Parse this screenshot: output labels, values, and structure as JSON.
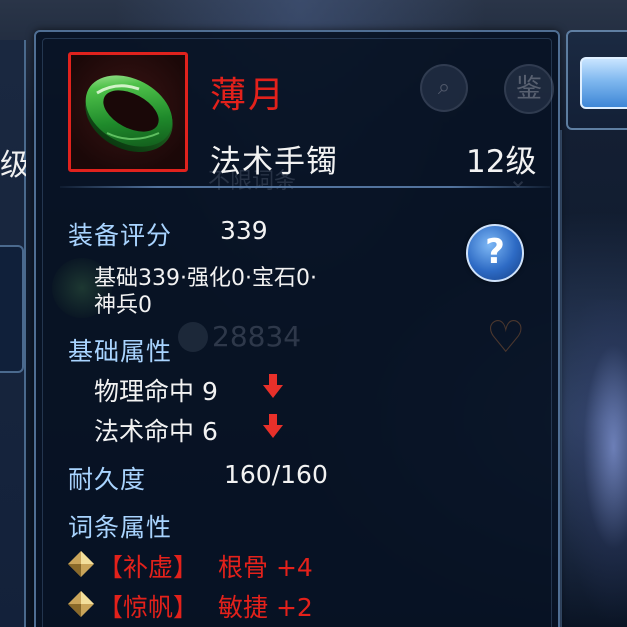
{
  "item": {
    "name": "薄月",
    "type": "法术手镯",
    "level": "12级"
  },
  "stats": {
    "score_label": "装备评分",
    "score_value": "339",
    "score_breakdown_line1": "基础339·强化0·宝石0·",
    "score_breakdown_line2": "神兵0",
    "base_attr_label": "基础属性",
    "attrs": [
      {
        "text": "物理命中 9",
        "trend": "down"
      },
      {
        "text": "法术命中 6",
        "trend": "down"
      }
    ],
    "durability_label": "耐久度",
    "durability_value": "160/160",
    "affix_label": "词条属性",
    "affixes": [
      {
        "tag": "【补虚】",
        "text": "根骨 +4"
      },
      {
        "tag": "【惊帆】",
        "text": "敏捷 +2"
      }
    ]
  },
  "help": {
    "label": "?"
  },
  "background": {
    "left_tab_text": "级",
    "filter_text": "不限词条",
    "price": "28834",
    "appraise_icon_text": "鉴"
  },
  "colors": {
    "item_name": "#e3211b",
    "label": "#a9d4ff",
    "frame": "#e0221d",
    "down_arrow": "#e8302a"
  },
  "icons": {
    "item": "jade-bracelet-icon",
    "help": "question-icon",
    "trend": "down-arrow-icon",
    "affix_bullet": "gold-diamond-icon"
  }
}
